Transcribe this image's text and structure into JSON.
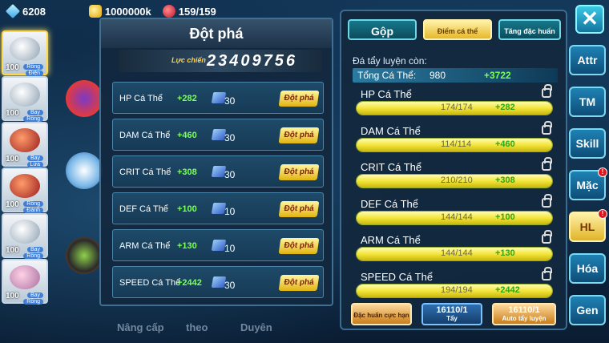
{
  "top_bar": {
    "gems": "6208",
    "coins": "1000000k",
    "stamina": "159/159"
  },
  "party": [
    {
      "level": "100",
      "tags": [
        "Rồng",
        "Điện"
      ],
      "active": true
    },
    {
      "level": "100",
      "tags": [
        "Bay",
        "Rồng"
      ]
    },
    {
      "level": "100",
      "tags": [
        "Bay",
        "Lửa"
      ]
    },
    {
      "level": "100",
      "tags": [
        "Rồng",
        "Đánh"
      ]
    },
    {
      "level": "100",
      "tags": [
        "Bay",
        "Rồng"
      ]
    },
    {
      "level": "100",
      "tags": [
        "Bay",
        "Rồng"
      ]
    }
  ],
  "bottom_tabs": [
    "Nâng cấp",
    "theo",
    "Duyên"
  ],
  "breakthrough_panel": {
    "title": "Đột phá",
    "power_label": "Lực chiến",
    "power_value": "23409756",
    "rows": [
      {
        "name": "HP Cá Thể",
        "add": "+282",
        "cost": "30",
        "button": "Đột phá"
      },
      {
        "name": "DAM Cá Thể",
        "add": "+460",
        "cost": "30",
        "button": "Đột phá"
      },
      {
        "name": "CRIT Cá Thể",
        "add": "+308",
        "cost": "30",
        "button": "Đột phá"
      },
      {
        "name": "DEF Cá Thể",
        "add": "+100",
        "cost": "10",
        "button": "Đột phá"
      },
      {
        "name": "ARM Cá Thể",
        "add": "+130",
        "cost": "10",
        "button": "Đột phá"
      },
      {
        "name": "SPEED Cá Thể",
        "add": "+2442",
        "cost": "30",
        "button": "Đột phá"
      }
    ]
  },
  "training_panel": {
    "tabs": [
      "Gộp",
      "Điểm cá thể",
      "Tăng đặc huấn"
    ],
    "subtitle": "Đá tẩy luyện còn:",
    "total": {
      "label": "Tổng Cá Thể:",
      "value": "980",
      "add": "+3722"
    },
    "stats": [
      {
        "name": "HP Cá Thể",
        "value": "174/174",
        "add": "+282",
        "fill": 1.0
      },
      {
        "name": "DAM Cá Thể",
        "value": "114/114",
        "add": "+460",
        "fill": 1.0
      },
      {
        "name": "CRIT Cá Thể",
        "value": "210/210",
        "add": "+308",
        "fill": 1.0
      },
      {
        "name": "DEF Cá Thể",
        "value": "144/144",
        "add": "+100",
        "fill": 1.0
      },
      {
        "name": "ARM Cá Thể",
        "value": "144/144",
        "add": "+130",
        "fill": 1.0
      },
      {
        "name": "SPEED Cá Thể",
        "value": "194/194",
        "add": "+2442",
        "fill": 1.0
      }
    ],
    "actions": {
      "special": "Đặc huấn cực hạn",
      "wash_count": "16110/1",
      "wash_label": "Tẩy",
      "auto_count": "16110/1",
      "auto_label": "Auto tẩy luyện"
    }
  },
  "right_nav": [
    "Attr",
    "TM",
    "Skill",
    "Mặc",
    "HL",
    "Hóa",
    "Gen"
  ],
  "notif_marks": [
    "!",
    "!"
  ],
  "active_nav": "HL"
}
